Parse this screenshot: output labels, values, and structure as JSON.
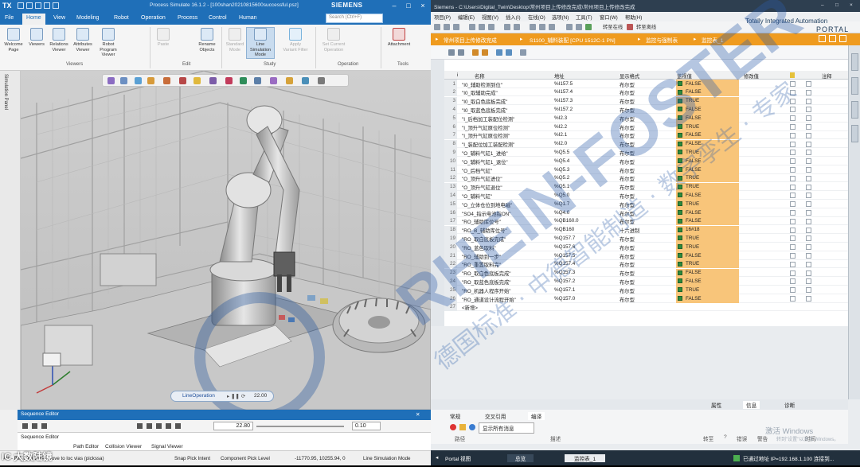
{
  "ps": {
    "logo": "TX",
    "title": "Process Simulate 16.1.2 - [100shan20210815600successful.psz]",
    "brand": "SIEMENS",
    "menu": [
      "File",
      "Home",
      "View",
      "Modeling",
      "Robot",
      "Operation",
      "Process",
      "Control",
      "Human"
    ],
    "active_menu": "Home",
    "search_placeholder": "Search (Ctrl+F)",
    "ribbon": {
      "viewers": [
        "Welcome Page",
        "Viewers",
        "Relations Viewer",
        "Attributes Viewer",
        "Robot Program Viewer"
      ],
      "viewers_group": "Viewers",
      "edit": [
        "Paste",
        "Rename Objects"
      ],
      "edit_group": "Edit",
      "study": [
        "Standard Mode",
        "Line Simulation Mode",
        "Apply Variant Filter"
      ],
      "study_group": "Study",
      "operation": [
        "Set Current Operation"
      ],
      "operation_group": "Operation",
      "tools": [
        "Attachment"
      ],
      "tools_group": "Tools"
    },
    "sidebar_label": "Simulation Panel",
    "line_operation": "LineOperation",
    "line_time": "22.00",
    "sequence_editor_title": "Sequence Editor",
    "seq_time": "22.80",
    "seq_rate": "0.10",
    "seq_tabs": [
      "Sequence Editor",
      "Path Editor",
      "Collision Viewer",
      "Signal Viewer"
    ],
    "status": {
      "left": "Alli - Bill_001(MOP) Move to loc vias (pickssa)",
      "pick": "Snap Pick Intent",
      "level": "Component Pick Level",
      "coords": "-11770.95, 10255.94, 0",
      "mode": "Line Simulation Mode"
    }
  },
  "tia": {
    "title": "Siemens - C:\\Users\\Digital_Twin\\Desktop\\常州项目上传修改完成\\常州项目上传修改完成",
    "menu": [
      "项目(P)",
      "编辑(E)",
      "视图(V)",
      "插入(I)",
      "在线(O)",
      "选项(N)",
      "工具(T)",
      "窗口(W)",
      "帮助(H)"
    ],
    "brand_line1": "Totally Integrated Automation",
    "brand_line2": "PORTAL",
    "toolbar_labels": [
      "转至在线",
      "转至离线"
    ],
    "breadcrumb": [
      "常州项目上传修改完成",
      "S1100_辅料装配 [CPU 1512C-1 PN]",
      "监控与强制表",
      "监控表_1"
    ],
    "columns": [
      "i",
      "名称",
      "地址",
      "显示格式",
      "监视值",
      "修改值",
      "",
      "注释"
    ],
    "rows": [
      {
        "n": "1",
        "name": "\"I0_辅助检测到位\"",
        "addr": "%I157.5",
        "fmt": "布尔型",
        "val": "FALSE"
      },
      {
        "n": "2",
        "name": "\"I0_取辅助完成\"",
        "addr": "%I157.4",
        "fmt": "布尔型",
        "val": "FALSE"
      },
      {
        "n": "3",
        "name": "\"I0_取白色底板完成\"",
        "addr": "%I157.3",
        "fmt": "布尔型",
        "val": "TRUE"
      },
      {
        "n": "4",
        "name": "\"I0_取蓝色底板完成\"",
        "addr": "%I157.2",
        "fmt": "布尔型",
        "val": "FALSE"
      },
      {
        "n": "5",
        "name": "\"I_后档加工装配位检测\"",
        "addr": "%I2.3",
        "fmt": "布尔型",
        "val": "FALSE"
      },
      {
        "n": "6",
        "name": "\"I_顶升气缸原位检测\"",
        "addr": "%I2.2",
        "fmt": "布尔型",
        "val": "TRUE"
      },
      {
        "n": "7",
        "name": "\"I_顶升气缸原位检测\"",
        "addr": "%I2.1",
        "fmt": "布尔型",
        "val": "FALSE"
      },
      {
        "n": "8",
        "name": "\"I_装配位加工装配检测\"",
        "addr": "%I2.0",
        "fmt": "布尔型",
        "val": "FALSE"
      },
      {
        "n": "9",
        "name": "\"O_辅料气缸1_进给\"",
        "addr": "%Q5.5",
        "fmt": "布尔型",
        "val": "TRUE"
      },
      {
        "n": "10",
        "name": "\"O_辅料气缸1_退位\"",
        "addr": "%Q5.4",
        "fmt": "布尔型",
        "val": "FALSE"
      },
      {
        "n": "11",
        "name": "\"O_后档气缸\"",
        "addr": "%Q5.3",
        "fmt": "布尔型",
        "val": "FALSE"
      },
      {
        "n": "12",
        "name": "\"O_顶升气缸进位\"",
        "addr": "%Q5.2",
        "fmt": "布尔型",
        "val": "TRUE"
      },
      {
        "n": "13",
        "name": "\"O_顶升气缸退位\"",
        "addr": "%Q5.1",
        "fmt": "布尔型",
        "val": "TRUE"
      },
      {
        "n": "14",
        "name": "\"O_辅料气缸\"",
        "addr": "%Q5.0",
        "fmt": "布尔型",
        "val": "FALSE"
      },
      {
        "n": "15",
        "name": "\"O_立体仓位到地电磁\"",
        "addr": "%Q1.7",
        "fmt": "布尔型",
        "val": "TRUE"
      },
      {
        "n": "16",
        "name": "\"SO4_指示电池指ON\"",
        "addr": "%Q4.0",
        "fmt": "布尔型",
        "val": "FALSE"
      },
      {
        "n": "17",
        "name": "\"RO_辅助库位号\"",
        "addr": "%QB160.0",
        "fmt": "布尔型",
        "val": "FALSE"
      },
      {
        "n": "18",
        "name": "\"RO_B_辅助库位号\"",
        "addr": "%QB160",
        "fmt": "十六进制",
        "val": "16#18"
      },
      {
        "n": "19",
        "name": "\"RO_取白底板完成\"",
        "addr": "%Q157.7",
        "fmt": "布尔型",
        "val": "TRUE"
      },
      {
        "n": "20",
        "name": "\"RO_蓝色取料\"",
        "addr": "%Q157.6",
        "fmt": "布尔型",
        "val": "TRUE"
      },
      {
        "n": "21",
        "name": "\"RO_辅助到一步\"",
        "addr": "%Q157.5",
        "fmt": "布尔型",
        "val": "FALSE"
      },
      {
        "n": "22",
        "name": "\"RO_重置取料完\"",
        "addr": "%Q157.4",
        "fmt": "布尔型",
        "val": "TRUE"
      },
      {
        "n": "23",
        "name": "\"RO_取白色底板完成\"",
        "addr": "%Q157.3",
        "fmt": "布尔型",
        "val": "FALSE"
      },
      {
        "n": "24",
        "name": "\"RO_取蓝色底板完成\"",
        "addr": "%Q157.2",
        "fmt": "布尔型",
        "val": "FALSE"
      },
      {
        "n": "25",
        "name": "\"RO_机器人程序开始\"",
        "addr": "%Q157.1",
        "fmt": "布尔型",
        "val": "TRUE"
      },
      {
        "n": "26",
        "name": "\"RO_通道设计流程开始\"",
        "addr": "%Q157.0",
        "fmt": "布尔型",
        "val": "FALSE"
      },
      {
        "n": "27",
        "name": "<新增>",
        "addr": "",
        "fmt": "",
        "val": ""
      }
    ],
    "inspector_tabs": [
      "属性",
      "信息",
      "诊断"
    ],
    "inspector_sub": [
      "常规",
      "交叉引用",
      "编译"
    ],
    "inspector_filter": "显示所有消息",
    "inspector_cols": [
      "路径",
      "描述",
      "转至",
      "?",
      "错误",
      "警告",
      "时间"
    ],
    "status": {
      "portal": "Portal 视图",
      "overview": "总览",
      "table": "监控表_1",
      "conn": "已通过地址 IP=192.168.1.100 连接到..."
    },
    "watermark": "激活 Windows",
    "watermark_sub": "转到\"设置\"以激活 Windows。"
  },
  "overlay": {
    "corner_text": "IC 大数陆镜",
    "wm_text": "RHEIN-FOSTER",
    "wm_cn": "德国标准 · 中德智能制造 · 数字孪生 · 专家"
  },
  "colors": {
    "ps_blue": "#1f6fb8",
    "tia_orange": "#ef9b1f",
    "monitor": "#f8c57a",
    "tia_dark": "#22303d"
  }
}
